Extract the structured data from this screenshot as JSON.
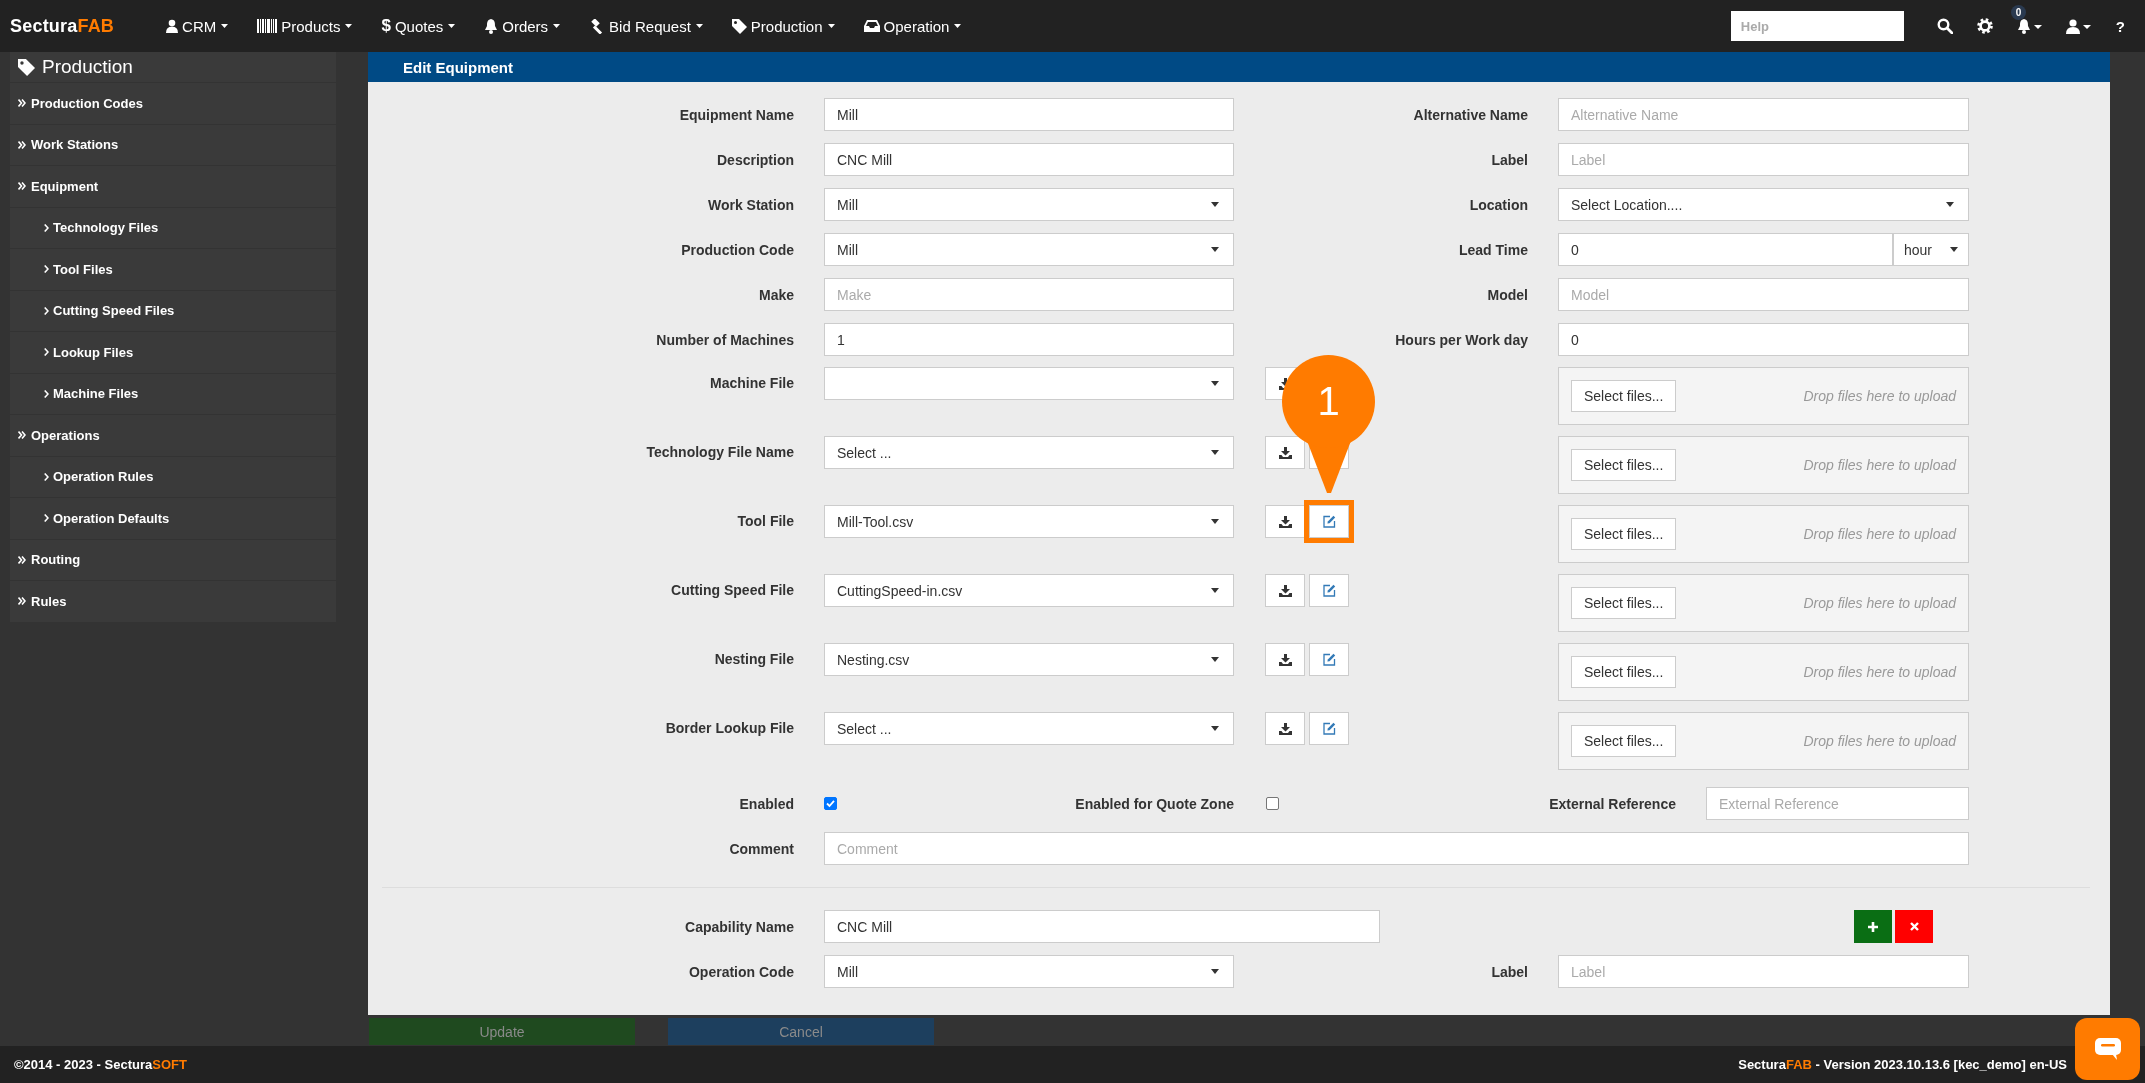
{
  "brand": {
    "name": "Sectura",
    "suffix": "FAB"
  },
  "nav": [
    {
      "label": "CRM",
      "kind": "user"
    },
    {
      "label": "Products",
      "kind": "barcode"
    },
    {
      "label": "Quotes",
      "glyph": "$"
    },
    {
      "label": "Orders",
      "kind": "bell"
    },
    {
      "label": "Bid Request",
      "kind": "gavel"
    },
    {
      "label": "Production",
      "kind": "tag"
    },
    {
      "label": "Operation",
      "kind": "inbox"
    }
  ],
  "toolbar": {
    "search_placeholder": "Help",
    "notification_count": "0",
    "help_glyph": "?"
  },
  "sidebar": {
    "title": "Production",
    "items": [
      {
        "label": "Production Codes"
      },
      {
        "label": "Work Stations"
      },
      {
        "label": "Equipment",
        "children": [
          {
            "label": "Technology Files"
          },
          {
            "label": "Tool Files"
          },
          {
            "label": "Cutting Speed Files"
          },
          {
            "label": "Lookup Files"
          },
          {
            "label": "Machine Files"
          }
        ]
      },
      {
        "label": "Operations",
        "children": [
          {
            "label": "Operation Rules"
          },
          {
            "label": "Operation Defaults"
          }
        ]
      },
      {
        "label": "Routing"
      },
      {
        "label": "Rules"
      }
    ]
  },
  "panel": {
    "title": "Edit Equipment",
    "rows": [
      {
        "left": {
          "label": "Equipment Name",
          "kind": "text",
          "value": "Mill"
        },
        "right": {
          "label": "Alternative Name",
          "kind": "text",
          "placeholder": "Alternative Name"
        }
      },
      {
        "left": {
          "label": "Description",
          "kind": "text",
          "value": "CNC Mill"
        },
        "right": {
          "label": "Label",
          "kind": "text",
          "placeholder": "Label"
        }
      },
      {
        "left": {
          "label": "Work Station",
          "kind": "select",
          "value": "Mill"
        },
        "right": {
          "label": "Location",
          "kind": "select",
          "value": "Select Location...."
        }
      },
      {
        "left": {
          "label": "Production Code",
          "kind": "select",
          "value": "Mill"
        },
        "right": {
          "label": "Lead Time",
          "kind": "unit",
          "value": "0",
          "unit": "hour"
        }
      },
      {
        "left": {
          "label": "Make",
          "kind": "text",
          "placeholder": "Make"
        },
        "right": {
          "label": "Model",
          "kind": "text",
          "placeholder": "Model"
        }
      },
      {
        "left": {
          "label": "Number of Machines",
          "kind": "text",
          "value": "1"
        },
        "right": {
          "label": "Hours per Work day",
          "kind": "text",
          "value": "0"
        }
      }
    ],
    "file_rows": [
      {
        "label": "Machine File",
        "upload": {
          "button": "Select files...",
          "hint": "Drop files here to upload"
        }
      },
      {
        "label": "Technology File Name",
        "value": "Select ...",
        "upload": {
          "button": "Select files...",
          "hint": "Drop files here to upload"
        }
      },
      {
        "label": "Tool File",
        "value": "Mill-Tool.csv",
        "callout": "1",
        "upload": {
          "button": "Select files...",
          "hint": "Drop files here to upload"
        }
      },
      {
        "label": "Cutting Speed File",
        "value": "CuttingSpeed-in.csv",
        "upload": {
          "button": "Select files...",
          "hint": "Drop files here to upload"
        }
      },
      {
        "label": "Nesting File",
        "value": "Nesting.csv",
        "upload": {
          "button": "Select files...",
          "hint": "Drop files here to upload"
        }
      },
      {
        "label": "Border Lookup File",
        "value": "Select ...",
        "upload": {
          "button": "Select files...",
          "hint": "Drop files here to upload"
        }
      }
    ],
    "flags": [
      {
        "label": "Enabled",
        "checked": true
      },
      {
        "label": "Enabled for Quote Zone",
        "checked": false
      }
    ],
    "external_reference": {
      "label": "External Reference",
      "placeholder": "External Reference"
    },
    "comment": {
      "label": "Comment",
      "placeholder": "Comment"
    },
    "capability": {
      "label": "Capability Name",
      "value": "CNC Mill"
    },
    "operation_code": {
      "label": "Operation Code",
      "value": "Mill"
    },
    "operation_label": {
      "label": "Label",
      "placeholder": "Label"
    }
  },
  "actions": [
    {
      "label": "Update",
      "kind": "primary"
    },
    {
      "label": "Cancel",
      "kind": "secondary"
    }
  ],
  "footer": {
    "copyright": "©2014 - 2023 - Sectura",
    "copyright_suffix": "SOFT",
    "brand": "Sectura",
    "brand_suffix": "FAB",
    "version": "- Version 2023.10.13.6 [kec_demo] en-US"
  }
}
